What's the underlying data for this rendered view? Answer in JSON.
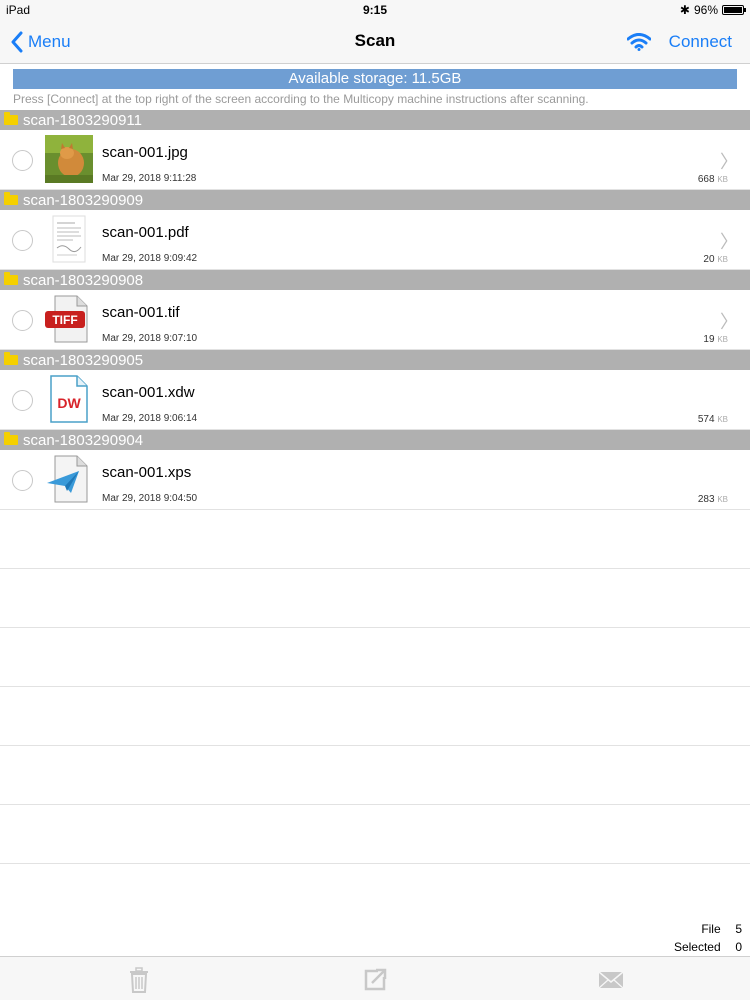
{
  "status_bar": {
    "device": "iPad",
    "time": "9:15",
    "battery": "96%",
    "battery_level": 0.96
  },
  "nav": {
    "back_label": "Menu",
    "title": "Scan",
    "connect_label": "Connect"
  },
  "storage": {
    "label": "Available storage:   11.5GB"
  },
  "instructions": "Press [Connect] at the top right of the screen according to the Multicopy machine instructions after scanning.",
  "groups": [
    {
      "folder": "scan-1803290911",
      "file": {
        "name": "scan-001.jpg",
        "date": "Mar 29, 2018 9:11:28",
        "size": "668",
        "unit": "KB",
        "thumb": "photo-thumbnail"
      }
    },
    {
      "folder": "scan-1803290909",
      "file": {
        "name": "scan-001.pdf",
        "date": "Mar 29, 2018 9:09:42",
        "size": "20",
        "unit": "KB",
        "thumb": "pdf-thumbnail"
      }
    },
    {
      "folder": "scan-1803290908",
      "file": {
        "name": "scan-001.tif",
        "date": "Mar 29, 2018 9:07:10",
        "size": "19",
        "unit": "KB",
        "thumb": "tiff-file-icon",
        "badge": "TIFF"
      }
    },
    {
      "folder": "scan-1803290905",
      "file": {
        "name": "scan-001.xdw",
        "date": "Mar 29, 2018 9:06:14",
        "size": "574",
        "unit": "KB",
        "thumb": "docuworks-file-icon",
        "badge": "DW"
      }
    },
    {
      "folder": "scan-1803290904",
      "file": {
        "name": "scan-001.xps",
        "date": "Mar 29, 2018 9:04:50",
        "size": "283",
        "unit": "KB",
        "thumb": "xps-file-icon"
      }
    }
  ],
  "counts": {
    "file_label": "File",
    "file_value": "5",
    "selected_label": "Selected",
    "selected_value": "0"
  },
  "colors": {
    "accent": "#1a7ef7",
    "storage_bar": "#6f9ed3",
    "group_header": "#b0b0b0",
    "folder": "#f5d000"
  }
}
